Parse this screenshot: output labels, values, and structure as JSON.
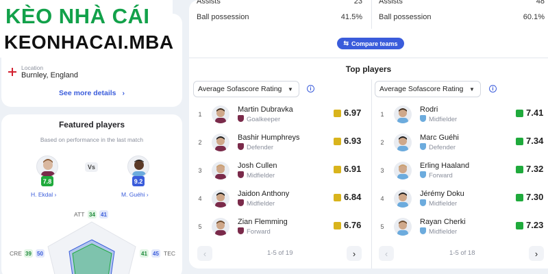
{
  "logo": {
    "line1": "KÈO NHÀ CÁI",
    "line2": "KEONHACAI.MBA"
  },
  "location": {
    "label": "Location",
    "value": "Burnley, England",
    "see_more": "See more details"
  },
  "featured": {
    "title": "Featured players",
    "subtitle": "Based on performance in the last match",
    "vs": "Vs",
    "left_player": {
      "name": "H. Ekdal",
      "rating": "7.8"
    },
    "right_player": {
      "name": "M. Guéhi",
      "rating": "9.2"
    },
    "attributes": {
      "att": {
        "label": "ATT",
        "left": "34",
        "right": "41"
      },
      "cre": {
        "label": "CRE",
        "left": "39",
        "right": "50"
      },
      "tec": {
        "label": "TEC",
        "left": "41",
        "right": "45"
      }
    }
  },
  "stats": {
    "left": [
      {
        "label": "Assists",
        "value": "23"
      },
      {
        "label": "Ball possession",
        "value": "41.5%"
      }
    ],
    "right": [
      {
        "label": "Assists",
        "value": "48"
      },
      {
        "label": "Ball possession",
        "value": "60.1%"
      }
    ]
  },
  "compare_label": "Compare teams",
  "top_players_title": "Top players",
  "left_panel": {
    "select": "Average Sofascore Rating",
    "pager": "1-5 of 19",
    "players": [
      {
        "rank": "1",
        "name": "Martin Dubravka",
        "position": "Goalkeeper",
        "rating": "6.97"
      },
      {
        "rank": "2",
        "name": "Bashir Humphreys",
        "position": "Defender",
        "rating": "6.93"
      },
      {
        "rank": "3",
        "name": "Josh Cullen",
        "position": "Midfielder",
        "rating": "6.91"
      },
      {
        "rank": "4",
        "name": "Jaidon Anthony",
        "position": "Midfielder",
        "rating": "6.84"
      },
      {
        "rank": "5",
        "name": "Zian Flemming",
        "position": "Forward",
        "rating": "6.76"
      }
    ]
  },
  "right_panel": {
    "select": "Average Sofascore Rating",
    "pager": "1-5 of 18",
    "players": [
      {
        "rank": "1",
        "name": "Rodri",
        "position": "Midfielder",
        "rating": "7.41"
      },
      {
        "rank": "2",
        "name": "Marc Guéhi",
        "position": "Defender",
        "rating": "7.34"
      },
      {
        "rank": "3",
        "name": "Erling Haaland",
        "position": "Forward",
        "rating": "7.32"
      },
      {
        "rank": "4",
        "name": "Jérémy Doku",
        "position": "Midfielder",
        "rating": "7.30"
      },
      {
        "rank": "5",
        "name": "Rayan Cherki",
        "position": "Midfielder",
        "rating": "7.23"
      }
    ]
  },
  "colors": {
    "accent": "#3a5cdb",
    "rating_yellow": "#d9b41c",
    "rating_green": "#1faa3c",
    "burnley_claret": "#7a2a4a",
    "city_blue": "#6cabdd"
  }
}
